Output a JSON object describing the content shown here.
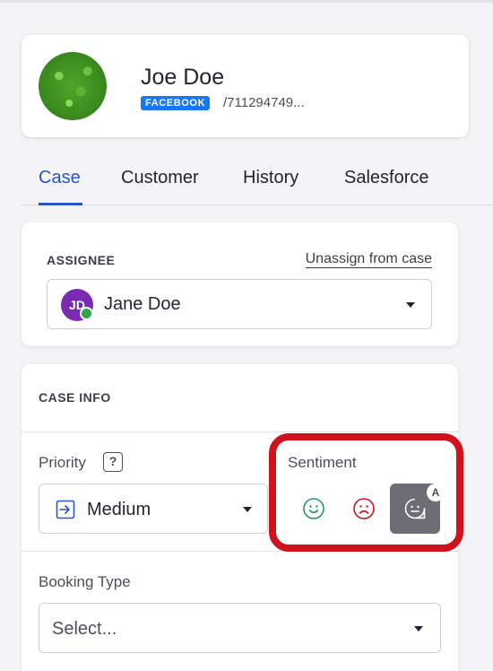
{
  "profile": {
    "name": "Joe Doe",
    "channel_badge": "FACEBOOK",
    "channel_id": "/711294749..."
  },
  "tabs": [
    {
      "label": "Case",
      "active": true
    },
    {
      "label": "Customer",
      "active": false
    },
    {
      "label": "History",
      "active": false
    },
    {
      "label": "Salesforce",
      "active": false
    }
  ],
  "assignee": {
    "section_label": "ASSIGNEE",
    "unassign_link": "Unassign from case",
    "initials": "JD",
    "name": "Jane Doe",
    "status": "online"
  },
  "case_info": {
    "section_label": "CASE INFO",
    "priority": {
      "label": "Priority",
      "help": "?",
      "value": "Medium"
    },
    "sentiment": {
      "label": "Sentiment",
      "options": [
        {
          "name": "positive",
          "icon": "happy-face-icon",
          "color": "#1f9a63"
        },
        {
          "name": "negative",
          "icon": "sad-face-icon",
          "color": "#d0121d"
        },
        {
          "name": "auto",
          "icon": "neutral-chat-face-icon",
          "badge": "A",
          "selected": true
        }
      ]
    },
    "booking_type": {
      "label": "Booking Type",
      "placeholder": "Select..."
    }
  },
  "colors": {
    "accent": "#2855c6",
    "facebook": "#1877f2",
    "highlight": "#d0121d",
    "avatar": "#7a2bb3",
    "online": "#2fa64a"
  }
}
